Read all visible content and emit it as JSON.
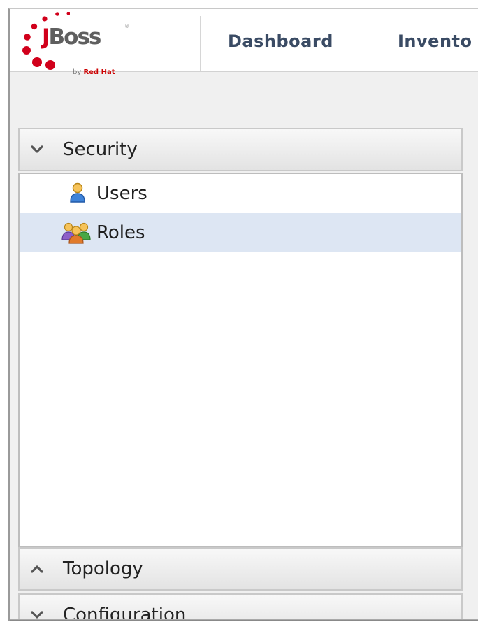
{
  "header": {
    "logo": {
      "brand_first": "J",
      "brand_rest": "Boss",
      "registered": "®",
      "byline_prefix": "by ",
      "byline_company": "Red Hat"
    },
    "tabs": [
      {
        "label": "Dashboard"
      },
      {
        "label": "Invento"
      }
    ]
  },
  "sidebar": {
    "sections": [
      {
        "label": "Security",
        "state": "expanded",
        "icon": "chevron-down-icon",
        "items": [
          {
            "label": "Users",
            "icon": "user-icon",
            "selected": false
          },
          {
            "label": "Roles",
            "icon": "roles-group-icon",
            "selected": true
          }
        ]
      },
      {
        "label": "Topology",
        "state": "collapsed",
        "icon": "chevron-up-icon"
      },
      {
        "label": "Configuration",
        "state": "collapsed",
        "icon": "chevron-down-icon"
      }
    ]
  },
  "colors": {
    "brand_red": "#d1001b",
    "tab_text": "#3a4b64",
    "selection_bg": "#dde6f3"
  }
}
